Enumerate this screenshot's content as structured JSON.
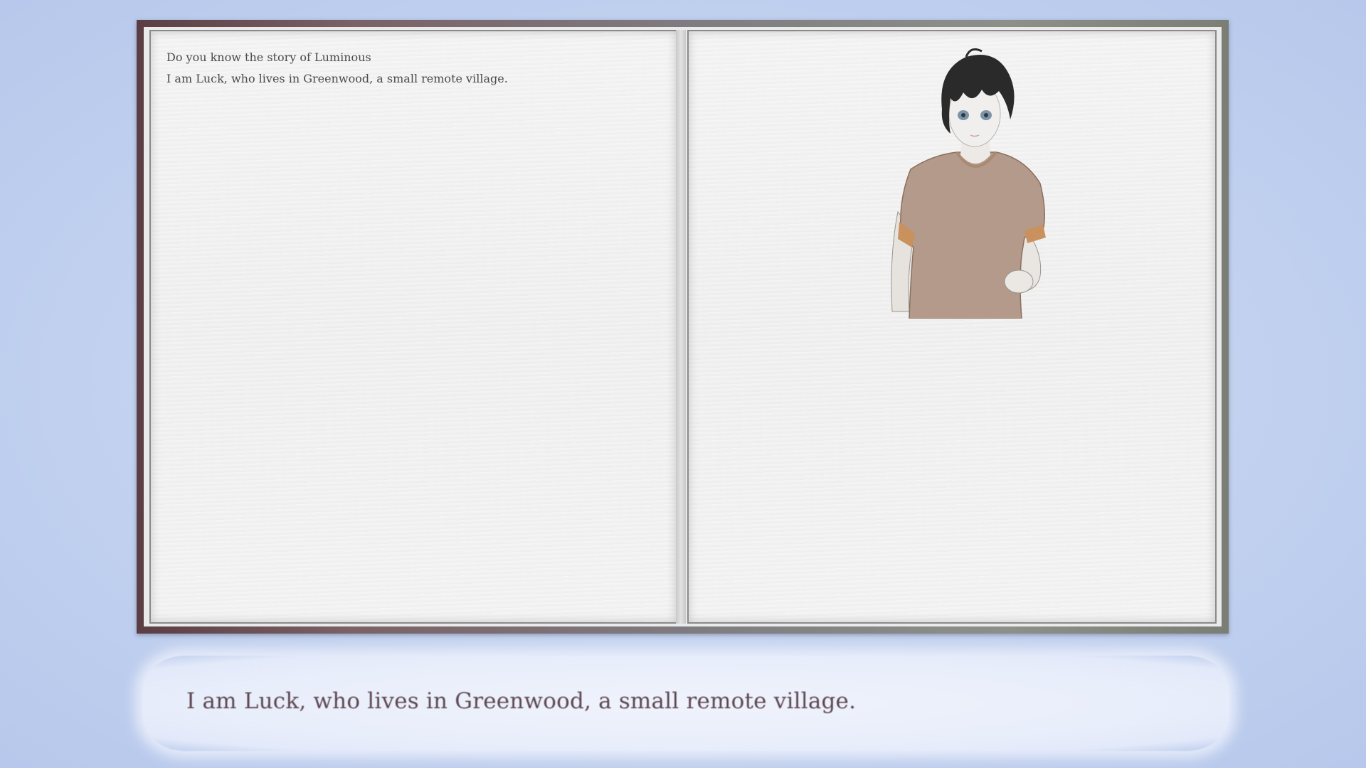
{
  "book": {
    "left_page": {
      "lines": [
        "Do you know the story of Luminous",
        "I am Luck, who lives in Greenwood, a small remote village."
      ]
    },
    "right_page": {
      "portrait": "character-luck"
    }
  },
  "dialog": {
    "text": "I am Luck, who lives in Greenwood, a small remote village."
  },
  "colors": {
    "background": "#c3d2ef",
    "dialog_text": "#5b4750",
    "page_text": "#4a4a4a",
    "page": "#f1f1f1"
  }
}
